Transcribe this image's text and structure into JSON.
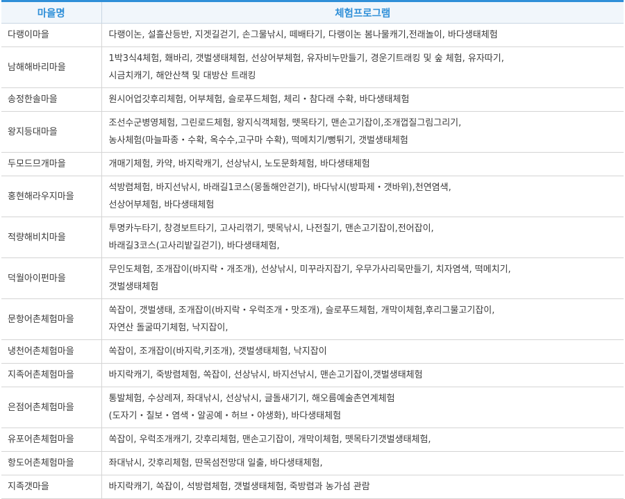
{
  "header": {
    "col_village": "마을명",
    "col_program": "체험프로그램"
  },
  "rows": [
    {
      "village": "다랭이마을",
      "lines": [
        "다랭이논, 설흘산등반, 지겟길걷기, 손그물낚시, 떼배타기, 다랭이논 봄나물캐기,전래놀이, 바다생태체험"
      ]
    },
    {
      "village": "남해해바리마을",
      "lines": [
        "1박3식4체험, 홰바리, 갯벌생태체험, 선상어부체험, 유자비누만들기, 경운기트래킹 및 숲 체험, 유자따기,",
        "시금치캐기, 해안산책 및 대방산 트래킹"
      ]
    },
    {
      "village": "송정한솔마을",
      "lines": [
        "원시어업갓후리체험, 어부체험, 슬로푸드체험, 체리・참다래 수확, 바다생태체험"
      ]
    },
    {
      "village": "왕지등대마을",
      "lines": [
        "조선수군병영체험, 그린로드체험, 왕지식객체험, 뗏목타기, 맨손고기잡이,조개껍질그림그리기,",
        "농사체험(마늘파종・수확, 옥수수,고구마 수확), 떡메치기/뻥튀기, 갯벌생태체험"
      ]
    },
    {
      "village": "두모드므개마을",
      "lines": [
        "개매기체험, 카약, 바지락캐기, 선상낚시, 노도문화체험, 바다생태체험"
      ]
    },
    {
      "village": "홍현해라우지마을",
      "lines": [
        "석방렴체험, 바지선낚시, 바래길1코스(몽돌해안걷기), 바다낚시(방파제・갯바위),천연염색,",
        "선상어부체험, 바다생태체험"
      ]
    },
    {
      "village": "적량해비치마을",
      "lines": [
        "투명카누타기, 창경보트타기, 고사리꺾기, 뗏목낚시, 나전칠기, 맨손고기잡이,전어잡이,",
        "바래길3코스(고사리밭길걷기), 바다생태체험,"
      ]
    },
    {
      "village": "덕월아이펀마을",
      "lines": [
        "무인도체험, 조개잡이(바지락・개조개), 선상낚시, 미꾸라지잡기, 우무가사리묵만들기, 치자염색, 떡메치기,",
        "갯벌생태체험"
      ]
    },
    {
      "village": "문항어촌체험마을",
      "lines": [
        "쏙잡이, 갯벌생태, 조개잡이(바지락・우럭조개・맛조개), 슬로푸드체험, 개막이체험,후리그물고기잡이,",
        "자연산 돌굴따기체험, 낙지잡이,"
      ]
    },
    {
      "village": "냉천어촌체험마을",
      "lines": [
        "쏙잡이, 조개잡이(바지락,키조개), 갯벌생태체험, 낙지잡이"
      ]
    },
    {
      "village": "지족어촌체험마을",
      "lines": [
        "바지락캐기, 죽방렴체험, 쏙잡이, 선상낚시, 바지선낚시, 맨손고기잡이,갯벌생태체험"
      ]
    },
    {
      "village": "은점어촌체험마을",
      "lines": [
        "통발체험, 수상레져, 좌대낚시, 선상낚시, 글돌새기기, 해오름예술촌연계체험",
        "(도자기・칠보・염색・알공예・허브・야생화), 바다생태체험"
      ]
    },
    {
      "village": "유포어촌체험마을",
      "lines": [
        "쏙잡이, 우럭조개캐기, 갓후리체험, 맨손고기잡이, 개막이체험, 뗏목타기갯벌생태체험,"
      ]
    },
    {
      "village": "항도어촌체험마을",
      "lines": [
        "좌대낚시, 갓후리체험, 딴목섬전망대 일출, 바다생태체험,"
      ]
    },
    {
      "village": "지족갯마을",
      "lines": [
        "바지락캐기, 쏙잡이, 석방렴체험, 갯벌생태체험, 죽방렴과 농가섬 관람"
      ]
    }
  ]
}
